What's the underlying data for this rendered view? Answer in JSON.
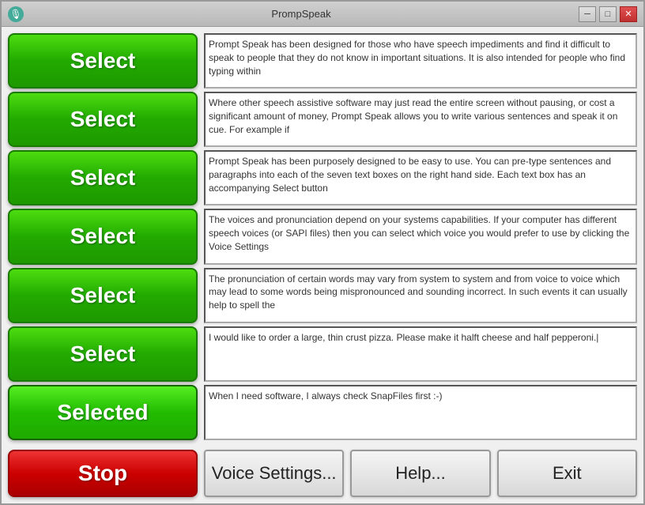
{
  "window": {
    "title": "PrompSpeak",
    "icon": "🎤"
  },
  "titlebar": {
    "minimize_label": "─",
    "restore_label": "□",
    "close_label": "✕"
  },
  "rows": [
    {
      "id": "row1",
      "button_label": "Select",
      "button_state": "normal",
      "text": "Prompt Speak has been designed for those who have speech impediments and find it difficult to speak to people that they do not know in important situations. It is also intended for people who find typing within"
    },
    {
      "id": "row2",
      "button_label": "Select",
      "button_state": "normal",
      "text": "Where other speech assistive software may just read the entire screen without pausing, or cost a significant amount of money, Prompt Speak allows you to write various sentences and speak it on cue. For example if"
    },
    {
      "id": "row3",
      "button_label": "Select",
      "button_state": "normal",
      "text": "Prompt Speak has been purposely designed to be easy to use. You can pre-type sentences and paragraphs into each of the seven text boxes on the right hand side. Each text box has an accompanying Select button"
    },
    {
      "id": "row4",
      "button_label": "Select",
      "button_state": "normal",
      "text": "The voices and pronunciation depend on your systems capabilities. If your computer has different speech voices (or SAPI files) then you can select which voice you would prefer to use by clicking the Voice Settings"
    },
    {
      "id": "row5",
      "button_label": "Select",
      "button_state": "normal",
      "text": "The pronunciation of certain words may vary from system to system and from voice to voice which may lead to some words being mispronounced and sounding incorrect. In such events it can usually help to spell the"
    },
    {
      "id": "row6",
      "button_label": "Select",
      "button_state": "normal",
      "text": "I would like to order a large, thin crust pizza. Please make it halft cheese and half pepperoni.|"
    },
    {
      "id": "row7",
      "button_label": "Selected",
      "button_state": "selected",
      "text": "When I need software, I always check SnapFiles first :-)"
    }
  ],
  "bottom": {
    "stop_label": "Stop",
    "voice_settings_label": "Voice Settings...",
    "help_label": "Help...",
    "exit_label": "Exit"
  }
}
